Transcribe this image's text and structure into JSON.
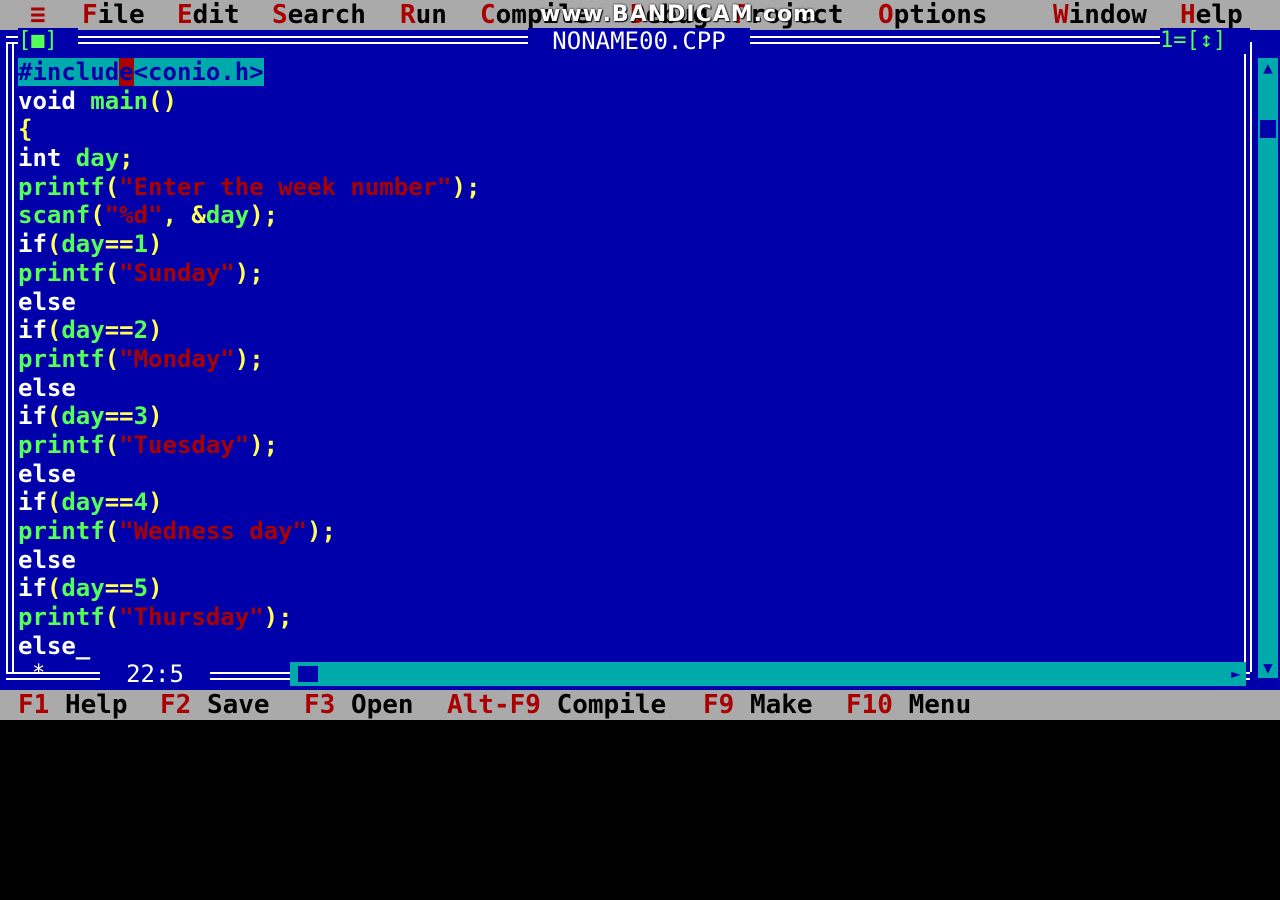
{
  "menubar": {
    "system": "≡",
    "items": [
      {
        "hot": "F",
        "rest": "ile"
      },
      {
        "hot": "E",
        "rest": "dit"
      },
      {
        "hot": "S",
        "rest": "earch"
      },
      {
        "hot": "R",
        "rest": "un"
      },
      {
        "hot": "C",
        "rest": "ompile"
      },
      {
        "hot": "D",
        "rest": "ebug"
      },
      {
        "hot": "P",
        "rest": "roject"
      },
      {
        "hot": "O",
        "rest": "ptions"
      },
      {
        "hot": "W",
        "rest": "indow"
      },
      {
        "hot": "H",
        "rest": "elp"
      }
    ]
  },
  "watermark": "www.BANDICAM.com",
  "window": {
    "close_box": "[■]",
    "title": " NONAME00.CPP ",
    "number": "1=[↕]"
  },
  "code": {
    "lines": [
      [
        {
          "t": "#includ",
          "c": "sel"
        },
        {
          "t": "e",
          "c": "cur"
        },
        {
          "t": "<conio.h>",
          "c": "sel"
        }
      ],
      [
        {
          "t": "void ",
          "c": "kw"
        },
        {
          "t": "main",
          "c": "id"
        },
        {
          "t": "()",
          "c": "pn"
        }
      ],
      [
        {
          "t": "{",
          "c": "pn"
        }
      ],
      [
        {
          "t": "int ",
          "c": "kw"
        },
        {
          "t": "day",
          "c": "id"
        },
        {
          "t": ";",
          "c": "pn"
        }
      ],
      [
        {
          "t": "printf",
          "c": "id"
        },
        {
          "t": "(",
          "c": "pn"
        },
        {
          "t": "\"Enter the week number\"",
          "c": "st"
        },
        {
          "t": ");",
          "c": "pn"
        }
      ],
      [
        {
          "t": "scanf",
          "c": "id"
        },
        {
          "t": "(",
          "c": "pn"
        },
        {
          "t": "\"%d\"",
          "c": "st"
        },
        {
          "t": ", &",
          "c": "pn"
        },
        {
          "t": "day",
          "c": "id"
        },
        {
          "t": ");",
          "c": "pn"
        }
      ],
      [
        {
          "t": "if",
          "c": "kw"
        },
        {
          "t": "(",
          "c": "pn"
        },
        {
          "t": "day",
          "c": "id"
        },
        {
          "t": "==",
          "c": "pn"
        },
        {
          "t": "1",
          "c": "nm"
        },
        {
          "t": ")",
          "c": "pn"
        }
      ],
      [
        {
          "t": "printf",
          "c": "id"
        },
        {
          "t": "(",
          "c": "pn"
        },
        {
          "t": "\"Sunday\"",
          "c": "st"
        },
        {
          "t": ");",
          "c": "pn"
        }
      ],
      [
        {
          "t": "else",
          "c": "kw"
        }
      ],
      [
        {
          "t": "if",
          "c": "kw"
        },
        {
          "t": "(",
          "c": "pn"
        },
        {
          "t": "day",
          "c": "id"
        },
        {
          "t": "==",
          "c": "pn"
        },
        {
          "t": "2",
          "c": "nm"
        },
        {
          "t": ")",
          "c": "pn"
        }
      ],
      [
        {
          "t": "printf",
          "c": "id"
        },
        {
          "t": "(",
          "c": "pn"
        },
        {
          "t": "\"Monday\"",
          "c": "st"
        },
        {
          "t": ");",
          "c": "pn"
        }
      ],
      [
        {
          "t": "else",
          "c": "kw"
        }
      ],
      [
        {
          "t": "if",
          "c": "kw"
        },
        {
          "t": "(",
          "c": "pn"
        },
        {
          "t": "day",
          "c": "id"
        },
        {
          "t": "==",
          "c": "pn"
        },
        {
          "t": "3",
          "c": "nm"
        },
        {
          "t": ")",
          "c": "pn"
        }
      ],
      [
        {
          "t": "printf",
          "c": "id"
        },
        {
          "t": "(",
          "c": "pn"
        },
        {
          "t": "\"Tuesday\"",
          "c": "st"
        },
        {
          "t": ");",
          "c": "pn"
        }
      ],
      [
        {
          "t": "else",
          "c": "kw"
        }
      ],
      [
        {
          "t": "if",
          "c": "kw"
        },
        {
          "t": "(",
          "c": "pn"
        },
        {
          "t": "day",
          "c": "id"
        },
        {
          "t": "==",
          "c": "pn"
        },
        {
          "t": "4",
          "c": "nm"
        },
        {
          "t": ")",
          "c": "pn"
        }
      ],
      [
        {
          "t": "printf",
          "c": "id"
        },
        {
          "t": "(",
          "c": "pn"
        },
        {
          "t": "\"Wedness day\"",
          "c": "st"
        },
        {
          "t": ");",
          "c": "pn"
        }
      ],
      [
        {
          "t": "else",
          "c": "kw"
        }
      ],
      [
        {
          "t": "if",
          "c": "kw"
        },
        {
          "t": "(",
          "c": "pn"
        },
        {
          "t": "day",
          "c": "id"
        },
        {
          "t": "==",
          "c": "pn"
        },
        {
          "t": "5",
          "c": "nm"
        },
        {
          "t": ")",
          "c": "pn"
        }
      ],
      [
        {
          "t": "printf",
          "c": "id"
        },
        {
          "t": "(",
          "c": "pn"
        },
        {
          "t": "\"Thursday\"",
          "c": "st"
        },
        {
          "t": ");",
          "c": "pn"
        }
      ],
      [
        {
          "t": "else",
          "c": "kw"
        },
        {
          "t": "_",
          "c": "caret"
        }
      ]
    ]
  },
  "status": {
    "modified": "*",
    "position": "22:5"
  },
  "fkeys": [
    {
      "key": "F1",
      "label": "Help"
    },
    {
      "key": "F2",
      "label": "Save"
    },
    {
      "key": "F3",
      "label": "Open"
    },
    {
      "key": "Alt-F9",
      "label": "Compile"
    },
    {
      "key": "F9",
      "label": "Make"
    },
    {
      "key": "F10",
      "label": "Menu"
    }
  ],
  "colors": {
    "editor_bg": "#0000aa",
    "menu_bg": "#aaaaaa",
    "hotkey": "#aa0000",
    "identifier": "#55ff55",
    "punct": "#ffff55",
    "string": "#aa0000",
    "selection": "#00aaaa"
  }
}
